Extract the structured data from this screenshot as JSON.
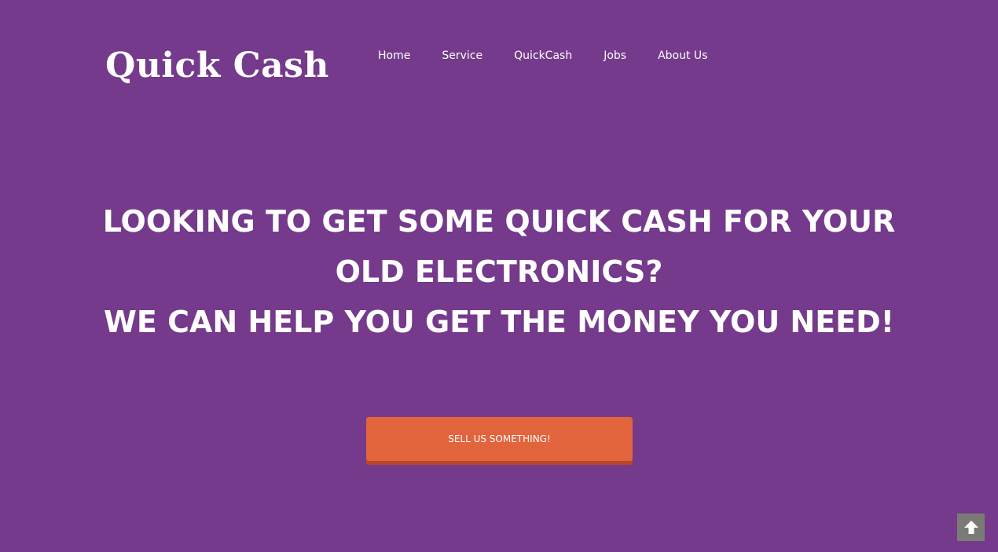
{
  "header": {
    "logo_text": "Quick Cash",
    "nav": [
      {
        "label": "Home"
      },
      {
        "label": "Service"
      },
      {
        "label": "QuickCash"
      },
      {
        "label": "Jobs"
      },
      {
        "label": "About Us"
      }
    ]
  },
  "hero": {
    "line1": "LOOKING TO GET SOME QUICK CASH FOR YOUR OLD ELECTRONICS?",
    "line2": "WE CAN HELP YOU GET THE MONEY YOU NEED!",
    "cta_label": "SELL US SOMETHING!"
  },
  "scroll_top": {
    "icon": "arrow-up-icon"
  },
  "colors": {
    "background": "#753a8b",
    "cta": "#e2643d",
    "cta_shadow": "#b8472a",
    "scroll_top_bg": "#7b7b75"
  }
}
